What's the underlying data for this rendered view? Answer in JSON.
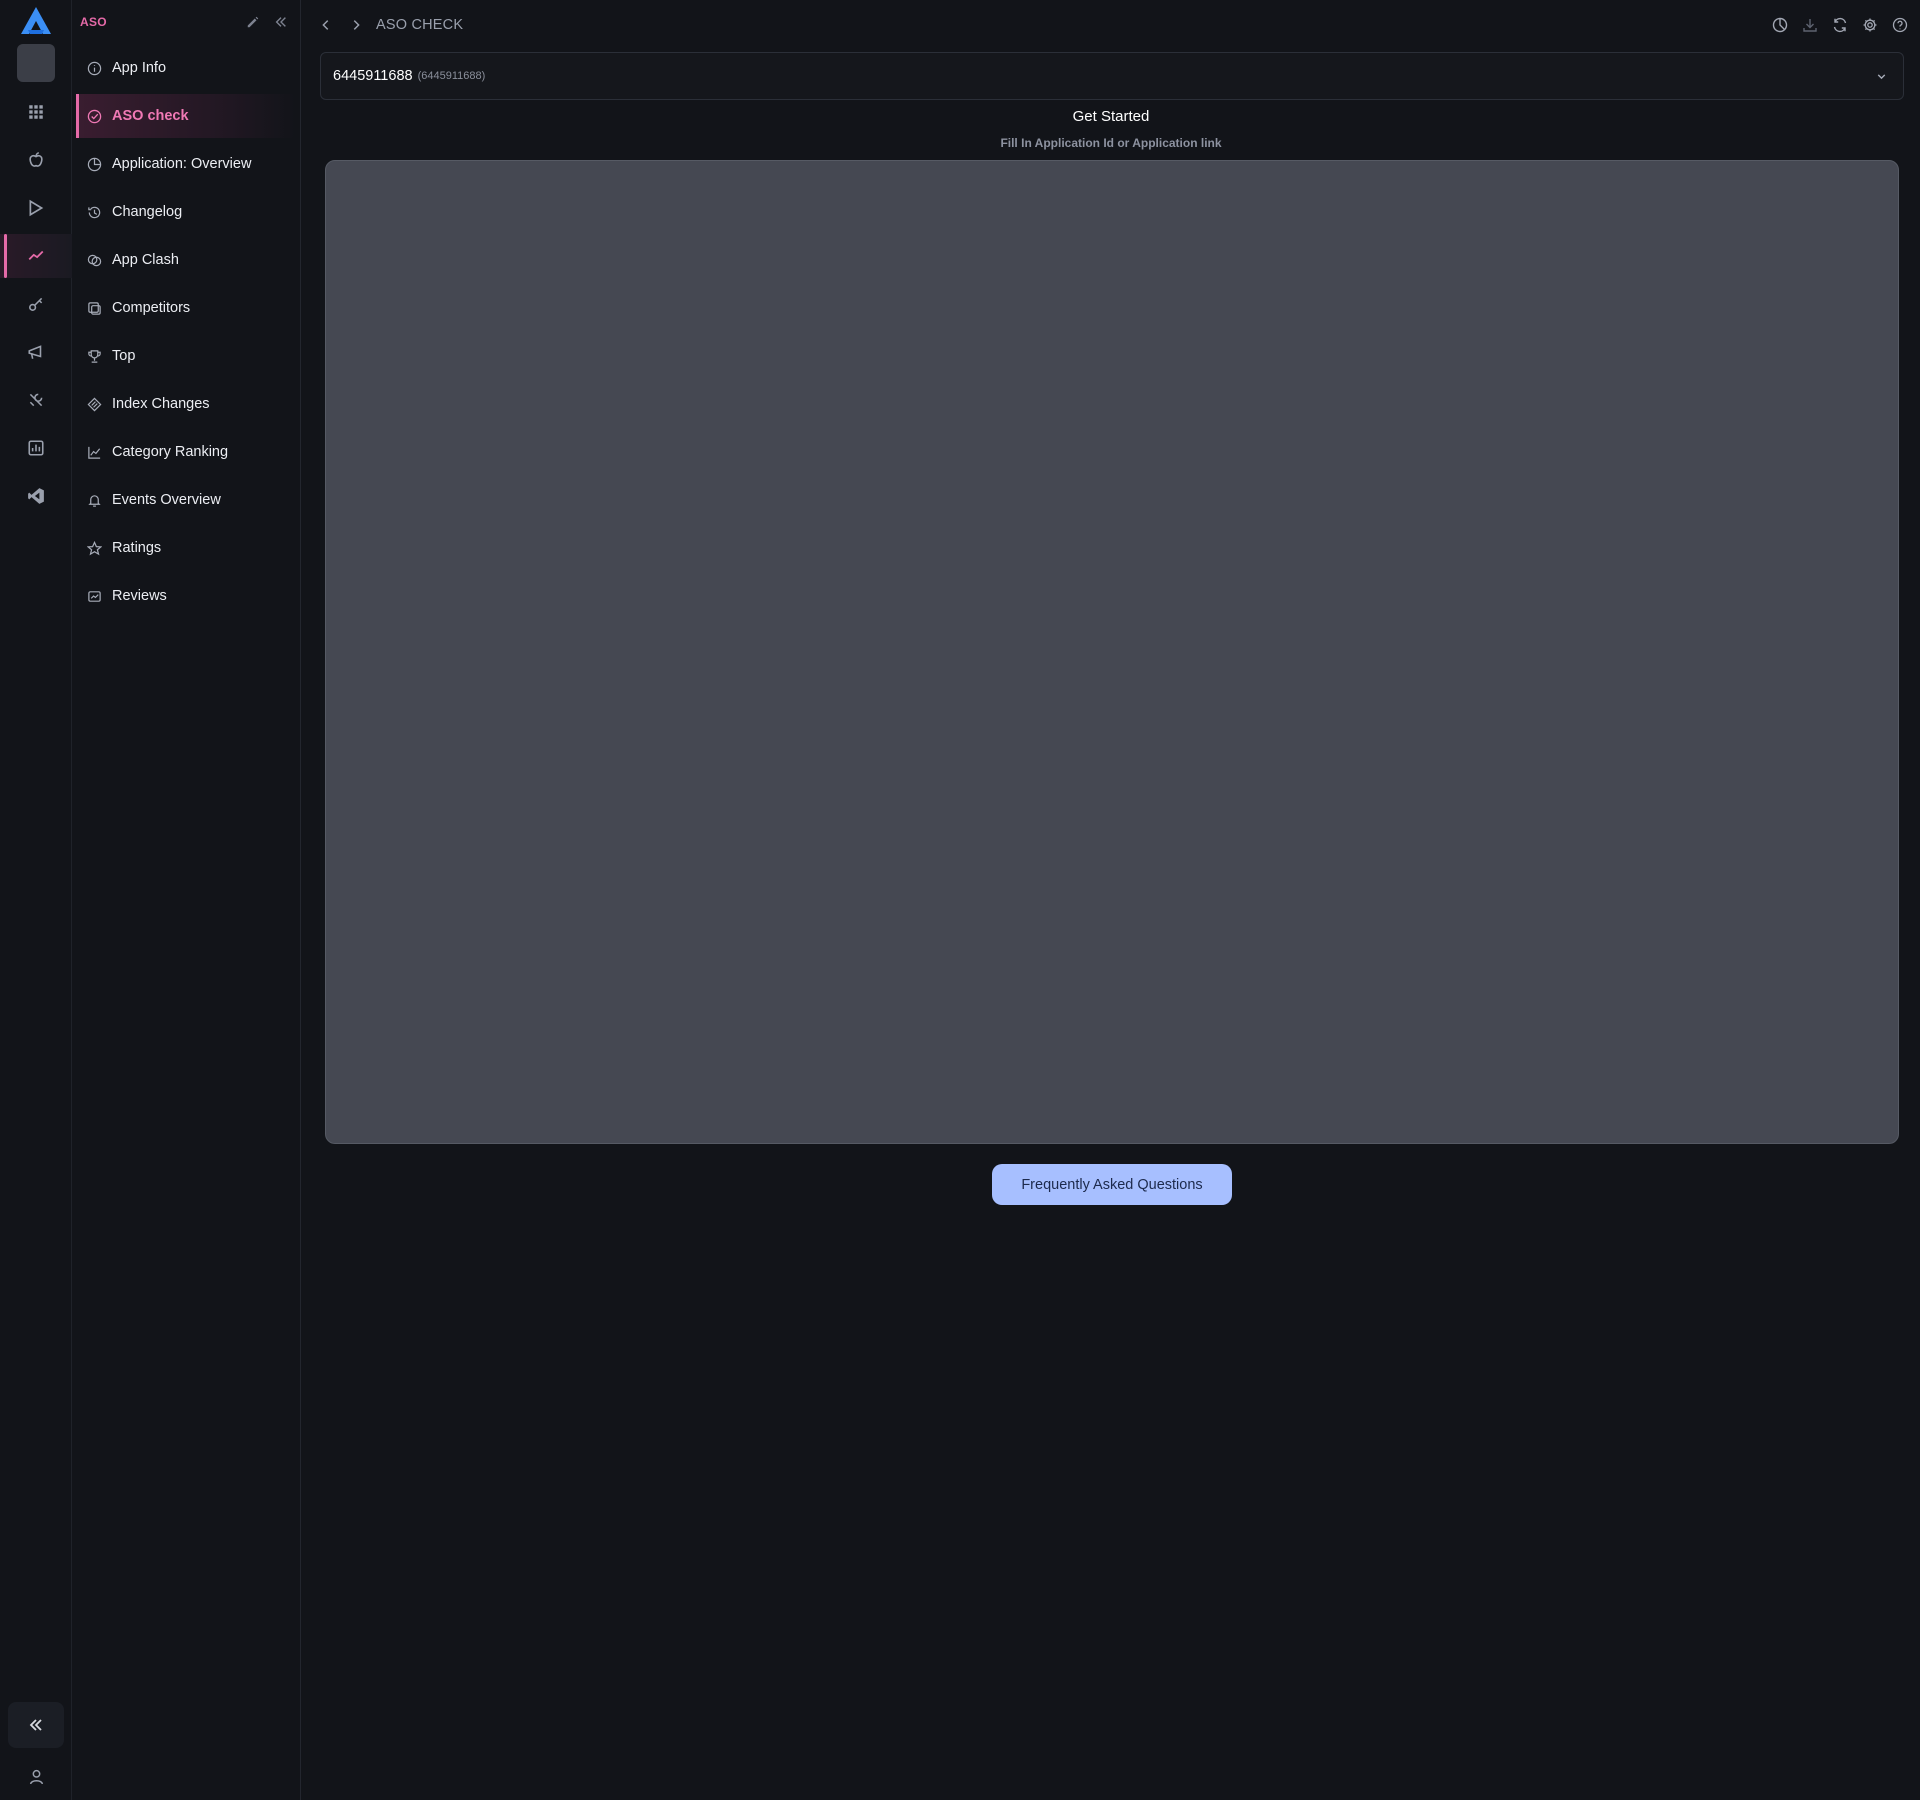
{
  "rail": {
    "logo_color": "#3b8ff5",
    "items": [
      {
        "name": "apps-grid-icon"
      },
      {
        "name": "apple-icon"
      },
      {
        "name": "google-play-icon"
      },
      {
        "name": "aso-trend-icon",
        "active": true
      },
      {
        "name": "key-icon"
      },
      {
        "name": "megaphone-icon"
      },
      {
        "name": "tools-icon"
      },
      {
        "name": "report-icon"
      },
      {
        "name": "vscode-icon"
      }
    ]
  },
  "menu": {
    "title": "ASO",
    "items": [
      {
        "label": "App Info",
        "icon": "info-icon"
      },
      {
        "label": "ASO check",
        "icon": "check-circle-icon",
        "active": true
      },
      {
        "label": "Application: Overview",
        "icon": "pie-chart-icon"
      },
      {
        "label": "Changelog",
        "icon": "history-icon"
      },
      {
        "label": "App Clash",
        "icon": "clash-icon"
      },
      {
        "label": "Competitors",
        "icon": "competitors-icon"
      },
      {
        "label": "Top",
        "icon": "trophy-icon"
      },
      {
        "label": "Index Changes",
        "icon": "index-icon"
      },
      {
        "label": "Category Ranking",
        "icon": "line-chart-icon"
      },
      {
        "label": "Events Overview",
        "icon": "bell-icon"
      },
      {
        "label": "Ratings",
        "icon": "star-icon"
      },
      {
        "label": "Reviews",
        "icon": "reviews-icon"
      }
    ]
  },
  "header": {
    "breadcrumb": "ASO CHECK"
  },
  "app_select": {
    "value": "6445911688",
    "sub": "(6445911688)"
  },
  "main": {
    "title": "Get Started",
    "hint": "Fill In Application Id or Application link",
    "faq_label": "Frequently Asked Questions"
  },
  "colors": {
    "accent": "#e56aa8",
    "faq_button": "#a7bfff",
    "background": "#121419"
  }
}
